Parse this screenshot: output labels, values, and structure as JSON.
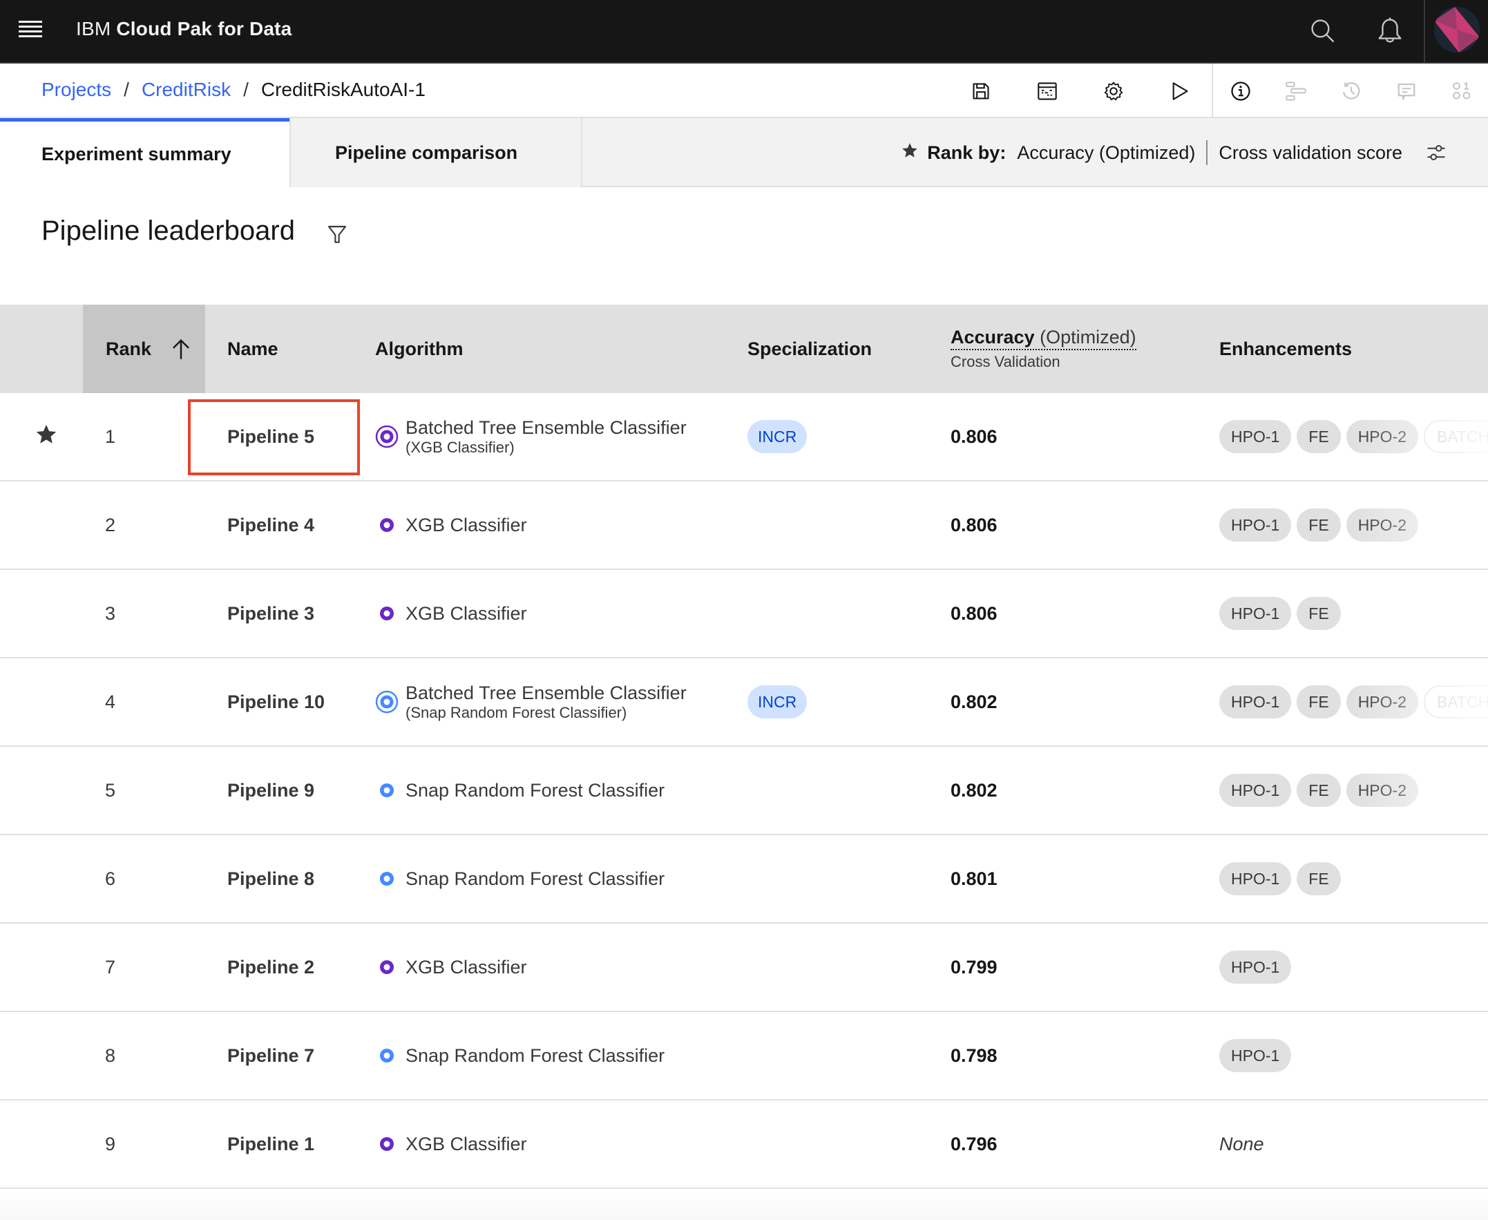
{
  "shell": {
    "brand_prefix": "IBM",
    "brand_product": "Cloud Pak for Data",
    "icons": [
      "menu-icon",
      "search-icon",
      "notification-icon",
      "user-avatar"
    ]
  },
  "breadcrumb": {
    "items": [
      {
        "label": "Projects",
        "link": true
      },
      {
        "label": "CreditRisk",
        "link": true
      },
      {
        "label": "CreditRiskAutoAI-1",
        "link": false
      }
    ],
    "separator": "/"
  },
  "toolbar": {
    "icons": [
      "save-icon",
      "data-table-icon",
      "settings-icon",
      "run-icon",
      "information-icon",
      "gantt-icon",
      "history-icon",
      "comment-icon",
      "model-icon"
    ]
  },
  "tabs": [
    {
      "label": "Experiment summary",
      "active": true
    },
    {
      "label": "Pipeline comparison",
      "active": false
    }
  ],
  "rank_by": {
    "label": "Rank by:",
    "metric": "Accuracy (Optimized)",
    "score_type": "Cross validation score"
  },
  "leaderboard": {
    "title": "Pipeline leaderboard",
    "columns": {
      "rank": "Rank",
      "name": "Name",
      "algorithm": "Algorithm",
      "specialization": "Specialization",
      "metric_main": "Accuracy",
      "metric_opt": "(Optimized)",
      "metric_sub": "Cross Validation",
      "enhancements": "Enhancements"
    },
    "sort": "ascending",
    "selected_row": 1,
    "rows": [
      {
        "starred": true,
        "rank": "1",
        "name": "Pipeline 5",
        "algorithm": "Batched Tree Ensemble Classifier",
        "algorithm_sub": "(XGB Classifier)",
        "alg_color": "#6929c4",
        "batched": true,
        "specialization": "INCR",
        "accuracy": "0.806",
        "enhancements": [
          "HPO-1",
          "FE",
          "HPO-2",
          "BATCH"
        ]
      },
      {
        "starred": false,
        "rank": "2",
        "name": "Pipeline 4",
        "algorithm": "XGB Classifier",
        "algorithm_sub": "",
        "alg_color": "#6929c4",
        "batched": false,
        "specialization": "",
        "accuracy": "0.806",
        "enhancements": [
          "HPO-1",
          "FE",
          "HPO-2"
        ]
      },
      {
        "starred": false,
        "rank": "3",
        "name": "Pipeline 3",
        "algorithm": "XGB Classifier",
        "algorithm_sub": "",
        "alg_color": "#6929c4",
        "batched": false,
        "specialization": "",
        "accuracy": "0.806",
        "enhancements": [
          "HPO-1",
          "FE"
        ]
      },
      {
        "starred": false,
        "rank": "4",
        "name": "Pipeline 10",
        "algorithm": "Batched Tree Ensemble Classifier",
        "algorithm_sub": "(Snap Random Forest Classifier)",
        "alg_color": "#4589ff",
        "batched": true,
        "specialization": "INCR",
        "accuracy": "0.802",
        "enhancements": [
          "HPO-1",
          "FE",
          "HPO-2",
          "BATCH"
        ]
      },
      {
        "starred": false,
        "rank": "5",
        "name": "Pipeline 9",
        "algorithm": "Snap Random Forest Classifier",
        "algorithm_sub": "",
        "alg_color": "#4589ff",
        "batched": false,
        "specialization": "",
        "accuracy": "0.802",
        "enhancements": [
          "HPO-1",
          "FE",
          "HPO-2"
        ]
      },
      {
        "starred": false,
        "rank": "6",
        "name": "Pipeline 8",
        "algorithm": "Snap Random Forest Classifier",
        "algorithm_sub": "",
        "alg_color": "#4589ff",
        "batched": false,
        "specialization": "",
        "accuracy": "0.801",
        "enhancements": [
          "HPO-1",
          "FE"
        ]
      },
      {
        "starred": false,
        "rank": "7",
        "name": "Pipeline 2",
        "algorithm": "XGB Classifier",
        "algorithm_sub": "",
        "alg_color": "#6929c4",
        "batched": false,
        "specialization": "",
        "accuracy": "0.799",
        "enhancements": [
          "HPO-1"
        ]
      },
      {
        "starred": false,
        "rank": "8",
        "name": "Pipeline 7",
        "algorithm": "Snap Random Forest Classifier",
        "algorithm_sub": "",
        "alg_color": "#4589ff",
        "batched": false,
        "specialization": "",
        "accuracy": "0.798",
        "enhancements": [
          "HPO-1"
        ]
      },
      {
        "starred": false,
        "rank": "9",
        "name": "Pipeline 1",
        "algorithm": "XGB Classifier",
        "algorithm_sub": "",
        "alg_color": "#6929c4",
        "batched": false,
        "specialization": "",
        "accuracy": "0.796",
        "enhancements": [],
        "enhancements_empty": "None"
      }
    ]
  },
  "colors": {
    "accent": "#3565f2",
    "xgb": "#6929c4",
    "snap": "#4589ff",
    "highlight": "#e8432a",
    "incr_bg": "#d0e2ff",
    "incr_fg": "#0043ce"
  }
}
